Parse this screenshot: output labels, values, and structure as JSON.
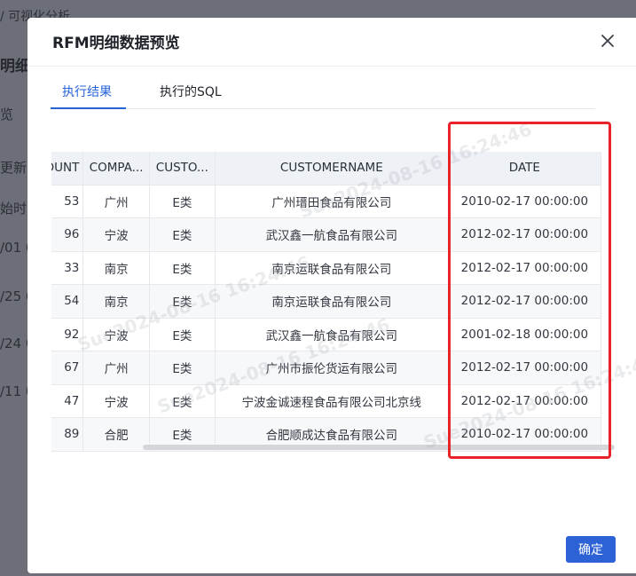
{
  "background": {
    "breadcrumb": "/ 可视化分析",
    "title_fragment": "明细",
    "label_fragment": "览",
    "col_fragment_1": "更新",
    "col_fragment_2": "始时间",
    "rows": [
      "/01 0",
      "/25 0",
      "/24 0",
      "/11 0"
    ]
  },
  "modal": {
    "title": "RFM明细数据预览",
    "tabs": [
      {
        "label": "执行结果",
        "active": true
      },
      {
        "label": "执行的SQL",
        "active": false
      }
    ],
    "confirm_label": "确定"
  },
  "table": {
    "columns": [
      "AMOUNT",
      "COMPANY",
      "CUSTOMERTYPE",
      "CUSTOMERNAME",
      "DATE"
    ],
    "column_display": [
      "OUNT",
      "COMPA...",
      "CUSTO...",
      "CUSTOMERNAME",
      "DATE"
    ],
    "rows": [
      {
        "amount": "53",
        "company": "广州",
        "type": "E类",
        "name": "广州瑨田食品有限公司",
        "date": "2010-02-17 00:00:00"
      },
      {
        "amount": "96",
        "company": "宁波",
        "type": "E类",
        "name": "武汉鑫一航食品有限公司",
        "date": "2012-02-17 00:00:00"
      },
      {
        "amount": "33",
        "company": "南京",
        "type": "E类",
        "name": "南京运联食品有限公司",
        "date": "2012-02-17 00:00:00"
      },
      {
        "amount": "54",
        "company": "南京",
        "type": "E类",
        "name": "南京运联食品有限公司",
        "date": "2012-02-17 00:00:00"
      },
      {
        "amount": "92",
        "company": "宁波",
        "type": "E类",
        "name": "武汉鑫一航食品有限公司",
        "date": "2001-02-18 00:00:00"
      },
      {
        "amount": "67",
        "company": "广州",
        "type": "E类",
        "name": "广州市振伦货运有限公司",
        "date": "2012-02-17 00:00:00"
      },
      {
        "amount": "47",
        "company": "宁波",
        "type": "E类",
        "name": "宁波金诚速程食品有限公司北京线",
        "date": "2012-02-17 00:00:00"
      },
      {
        "amount": "89",
        "company": "合肥",
        "type": "E类",
        "name": "合肥顺成达食品有限公司",
        "date": "2010-02-17 00:00:00"
      }
    ]
  },
  "watermark": "Sue2024-08-16 16:24:46",
  "colors": {
    "accent": "#2563d9",
    "highlight": "#e8232a",
    "header_bg": "#eef1f6"
  }
}
